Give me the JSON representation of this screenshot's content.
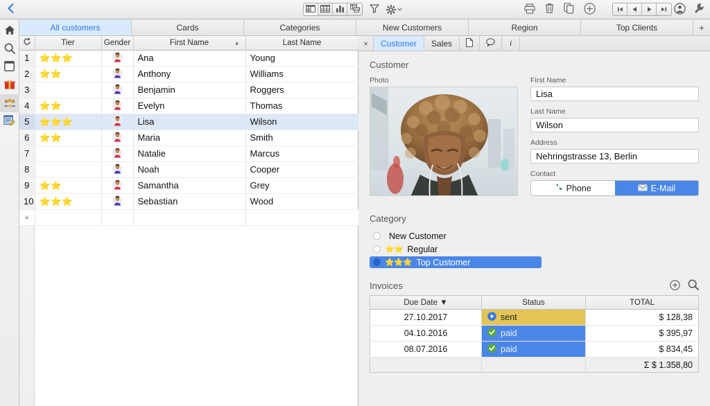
{
  "toolbar": {
    "back_label": "‹",
    "view_modes": [
      {
        "name": "form-view",
        "label": "form-view-icon",
        "active": true
      },
      {
        "name": "table-view",
        "label": "table-view-icon",
        "active": false
      },
      {
        "name": "chart-view",
        "label": "chart-view-icon",
        "active": false
      },
      {
        "name": "report-view",
        "label": "report-view-icon",
        "active": false
      }
    ],
    "filter_label": "filter-icon",
    "settings_label": "gear-icon",
    "actions": [
      "print-icon",
      "trash-icon",
      "duplicate-icon",
      "add-icon"
    ],
    "nav": [
      "first-record-icon",
      "previous-record-icon",
      "next-record-icon",
      "last-record-icon"
    ],
    "account_label": "account-icon",
    "tools_label": "wrench-icon"
  },
  "sidebar": {
    "items": [
      {
        "name": "home",
        "icon": "home-icon",
        "selected": false
      },
      {
        "name": "search",
        "icon": "search-icon",
        "selected": false
      },
      {
        "name": "cards",
        "icon": "card-icon",
        "selected": false
      },
      {
        "name": "gifts",
        "icon": "gift-icon",
        "selected": false
      },
      {
        "name": "customers",
        "icon": "people-icon",
        "selected": true
      },
      {
        "name": "forms",
        "icon": "form-edit-icon",
        "selected": false
      }
    ]
  },
  "layout_tabs": {
    "items": [
      {
        "label": "All customers",
        "active": true
      },
      {
        "label": "Cards",
        "active": false
      },
      {
        "label": "Categories",
        "active": false
      },
      {
        "label": "New Customers",
        "active": false
      },
      {
        "label": "Region",
        "active": false
      },
      {
        "label": "Top Clients",
        "active": false
      }
    ],
    "add_label": "+"
  },
  "table": {
    "refresh_label": "refresh-icon",
    "columns": [
      {
        "label": "Tier",
        "sort": ""
      },
      {
        "label": "Gender",
        "sort": ""
      },
      {
        "label": "First Name",
        "sort": "asc"
      },
      {
        "label": "Last Name",
        "sort": ""
      }
    ],
    "rows": [
      {
        "num": "1",
        "tier": 3,
        "gender": "female",
        "first": "Ana",
        "last": "Young",
        "selected": false
      },
      {
        "num": "2",
        "tier": 2,
        "gender": "male",
        "first": "Anthony",
        "last": "Williams",
        "selected": false
      },
      {
        "num": "3",
        "tier": 0,
        "gender": "male",
        "first": "Benjamin",
        "last": "Roggers",
        "selected": false
      },
      {
        "num": "4",
        "tier": 2,
        "gender": "female",
        "first": "Evelyn",
        "last": "Thomas",
        "selected": false
      },
      {
        "num": "5",
        "tier": 3,
        "gender": "female",
        "first": "Lisa",
        "last": "Wilson",
        "selected": true
      },
      {
        "num": "6",
        "tier": 2,
        "gender": "female",
        "first": "Maria",
        "last": "Smith",
        "selected": false
      },
      {
        "num": "7",
        "tier": 0,
        "gender": "female",
        "first": "Natalie",
        "last": "Marcus",
        "selected": false
      },
      {
        "num": "8",
        "tier": 0,
        "gender": "male",
        "first": "Noah",
        "last": "Cooper",
        "selected": false
      },
      {
        "num": "9",
        "tier": 2,
        "gender": "female",
        "first": "Samantha",
        "last": "Grey",
        "selected": false
      },
      {
        "num": "10",
        "tier": 3,
        "gender": "male",
        "first": "Sebastian",
        "last": "Wood",
        "selected": false
      }
    ],
    "add_row_label": "+"
  },
  "detail_tabs": {
    "close_label": "×",
    "items": [
      {
        "label": "Customer",
        "active": true
      },
      {
        "label": "Sales",
        "active": false
      },
      {
        "label": "document-icon",
        "active": false,
        "icon": true
      },
      {
        "label": "comment-icon",
        "active": false,
        "icon": true
      },
      {
        "label": "i",
        "active": false,
        "italic": true
      }
    ]
  },
  "customer": {
    "section_title": "Customer",
    "photo_label": "Photo",
    "fields": [
      {
        "label": "First Name",
        "value": "Lisa"
      },
      {
        "label": "Last Name",
        "value": "Wilson"
      },
      {
        "label": "Address",
        "value": "Nehringstrasse 13, Berlin"
      }
    ],
    "contact_label": "Contact",
    "contact_buttons": [
      {
        "label": "Phone",
        "icon": "phone-icon",
        "selected": false
      },
      {
        "label": "E-Mail",
        "icon": "mail-icon",
        "selected": true
      }
    ]
  },
  "category": {
    "title": "Category",
    "options": [
      {
        "label": "New Customer",
        "stars": 0,
        "selected": false
      },
      {
        "label": "Regular",
        "stars": 2,
        "selected": false
      },
      {
        "label": "Top Customer",
        "stars": 3,
        "selected": true
      }
    ]
  },
  "invoices": {
    "title": "Invoices",
    "add_label": "add-invoice-icon",
    "search_label": "search-invoice-icon",
    "columns": [
      {
        "label": "Due Date",
        "sort": "desc"
      },
      {
        "label": "Status",
        "sort": ""
      },
      {
        "label": "TOTAL",
        "sort": ""
      }
    ],
    "rows": [
      {
        "due": "27.10.2017",
        "status": "sent",
        "status_kind": "sent",
        "total": "$ 128,38"
      },
      {
        "due": "04.10.2016",
        "status": "paid",
        "status_kind": "paid",
        "total": "$ 395,97"
      },
      {
        "due": "08.07.2016",
        "status": "paid",
        "status_kind": "paid",
        "total": "$ 834,45"
      }
    ],
    "summary": "Σ $ 1.358,80"
  },
  "colors": {
    "accent_blue": "#4a86e8",
    "tab_active_bg": "#d9eaff",
    "tab_active_text": "#2f7bf0",
    "row_selected": "#dde8f7",
    "status_sent": "#e3c556",
    "status_paid": "#4a86e8",
    "check_green": "#59a83c",
    "gift_red": "#d4342c"
  }
}
